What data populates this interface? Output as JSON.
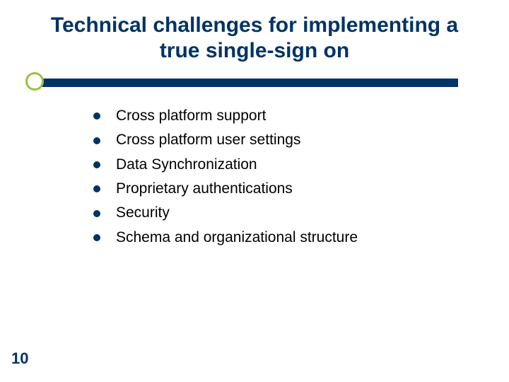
{
  "title": "Technical challenges for implementing a true  single-sign on",
  "bullets": {
    "0": "Cross platform support",
    "1": "Cross platform user settings",
    "2": "Data Synchronization",
    "3": "Proprietary authentications",
    "4": "Security",
    "5": "Schema and organizational structure"
  },
  "pageNumber": "10"
}
